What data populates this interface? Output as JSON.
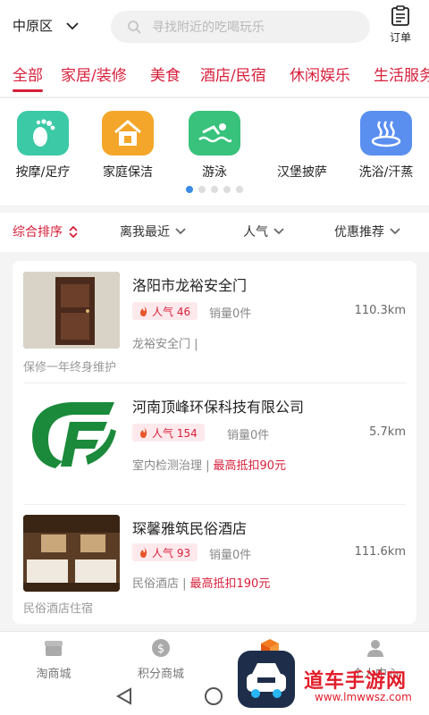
{
  "header": {
    "location": "中原区",
    "search_placeholder": "寻找附近的吃喝玩乐",
    "order_label": "订单"
  },
  "categories": [
    "全部",
    "家居/装修",
    "美食",
    "酒店/民宿",
    "休闲娱乐",
    "生活服务"
  ],
  "services": [
    {
      "label": "按摩/足疗",
      "icon": "footprint-icon",
      "color": "#3cc9a6"
    },
    {
      "label": "家庭保洁",
      "icon": "house-icon",
      "color": "#f4a62a"
    },
    {
      "label": "游泳",
      "icon": "swimmer-icon",
      "color": "#38c27c"
    },
    {
      "label": "汉堡披萨",
      "icon": "burger-icon",
      "color": "#ffffff"
    },
    {
      "label": "洗浴/汗蒸",
      "icon": "hot-spring-icon",
      "color": "#5a8ff0"
    }
  ],
  "filters": [
    "综合排序",
    "离我最近",
    "人气",
    "优惠推荐"
  ],
  "items": [
    {
      "title": "洛阳市龙裕安全门",
      "popularity": "人气 46",
      "sales": "销量0件",
      "distance": "110.3km",
      "tag": "龙裕安全门 |",
      "highlight": "",
      "desc": "保修一年终身维护"
    },
    {
      "title": "河南顶峰环保科技有限公司",
      "popularity": "人气 154",
      "sales": "销量0件",
      "distance": "5.7km",
      "tag": "室内检测治理 |",
      "highlight": "最高抵扣90元",
      "desc": ""
    },
    {
      "title": "琛馨雅筑民俗酒店",
      "popularity": "人气 93",
      "sales": "销量0件",
      "distance": "111.6km",
      "tag": "民俗酒店 |",
      "highlight": "最高抵扣190元",
      "desc": "民俗酒店住宿"
    }
  ],
  "tabbar": [
    "淘商城",
    "积分商城",
    "",
    "个人中心"
  ],
  "watermark": {
    "text": "道车手游网",
    "sub": "www.lmwwsz.com"
  },
  "colors": {
    "accent": "#d61f3b",
    "indicator": "#3a8be6"
  }
}
